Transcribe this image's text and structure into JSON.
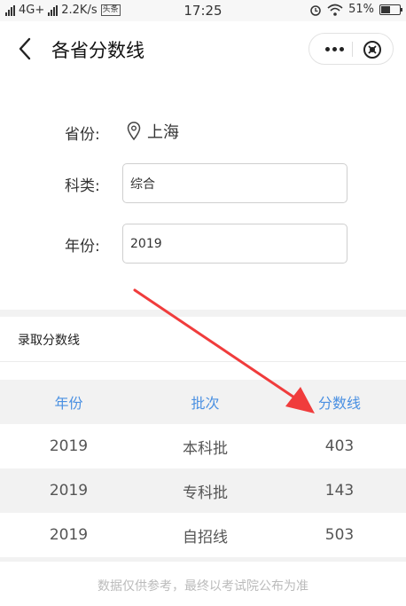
{
  "status_bar": {
    "network_label": "4G+",
    "speed": "2.2K/s",
    "app_badge": "头条",
    "time": "17:25",
    "battery_percent": "51%",
    "battery_level": 0.51
  },
  "header": {
    "title": "各省分数线",
    "more_icon": "ellipsis-icon",
    "close_icon": "close-circle-icon"
  },
  "form": {
    "province_label": "省份:",
    "province_value": "上海",
    "category_label": "科类:",
    "category_value": "综合",
    "year_label": "年份:",
    "year_value": "2019"
  },
  "scores": {
    "section_title": "录取分数线",
    "columns": [
      "年份",
      "批次",
      "分数线"
    ],
    "rows": [
      [
        "2019",
        "本科批",
        "403"
      ],
      [
        "2019",
        "专科批",
        "143"
      ],
      [
        "2019",
        "自招线",
        "503"
      ]
    ]
  },
  "footer": {
    "note": "数据仅供参考，最终以考试院公布为准"
  },
  "colors": {
    "accent": "#4a90e2",
    "annotation_arrow": "#f03c3c",
    "table_header_bg": "#f2f2f2"
  }
}
